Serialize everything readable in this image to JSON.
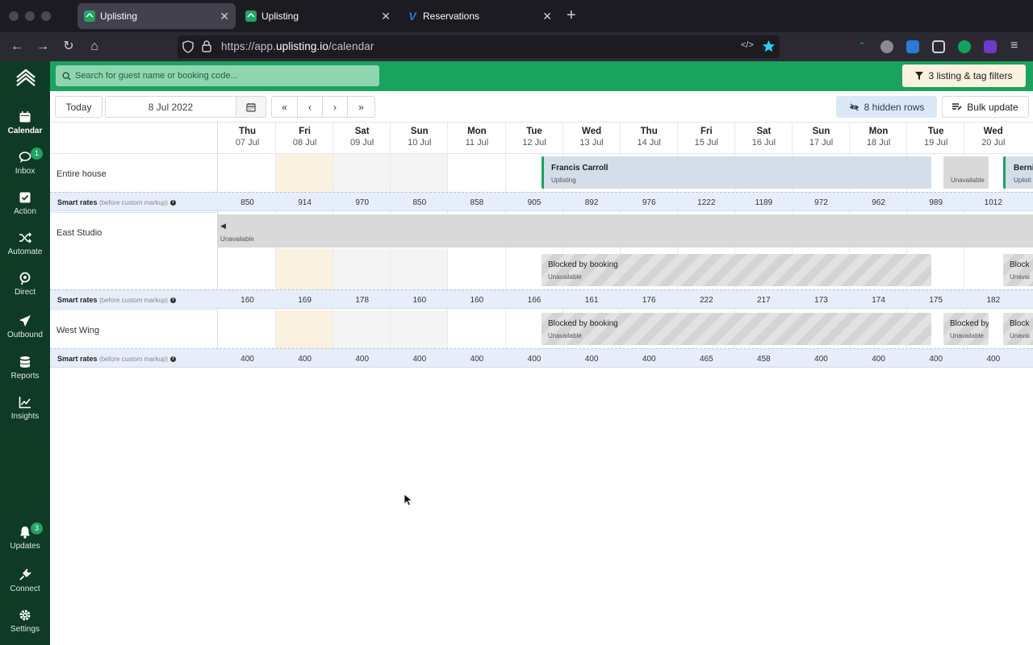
{
  "browser": {
    "tabs": [
      {
        "title": "Uplisting",
        "active": true
      },
      {
        "title": "Uplisting",
        "active": false
      },
      {
        "title": "Reservations",
        "active": false
      }
    ],
    "url_prefix": "https://app.",
    "url_domain": "uplisting.io",
    "url_path": "/calendar"
  },
  "sidebar": {
    "items": [
      {
        "label": "Calendar",
        "icon": "calendar-icon"
      },
      {
        "label": "Inbox",
        "icon": "chat-icon",
        "badge": "1"
      },
      {
        "label": "Action",
        "icon": "check-square-icon"
      },
      {
        "label": "Automate",
        "icon": "shuffle-icon"
      },
      {
        "label": "Direct",
        "icon": "direct-icon"
      },
      {
        "label": "Outbound",
        "icon": "paper-plane-icon"
      },
      {
        "label": "Reports",
        "icon": "database-icon"
      },
      {
        "label": "Insights",
        "icon": "chart-line-icon"
      },
      {
        "label": "Updates",
        "icon": "bell-icon",
        "badge": "3"
      },
      {
        "label": "Connect",
        "icon": "plug-icon"
      },
      {
        "label": "Settings",
        "icon": "gear-icon"
      }
    ]
  },
  "header": {
    "search_placeholder": "Search for guest name or booking code...",
    "filters_label": "3 listing & tag filters"
  },
  "toolbar": {
    "today_label": "Today",
    "date_value": "8 Jul 2022",
    "first_label": "«",
    "prev_label": "‹",
    "next_label": "›",
    "last_label": "»",
    "hidden_rows_label": "8 hidden rows",
    "bulk_update_label": "Bulk update"
  },
  "days": [
    {
      "name": "Thu",
      "date": "07 Jul"
    },
    {
      "name": "Fri",
      "date": "08 Jul"
    },
    {
      "name": "Sat",
      "date": "09 Jul"
    },
    {
      "name": "Sun",
      "date": "10 Jul"
    },
    {
      "name": "Mon",
      "date": "11 Jul"
    },
    {
      "name": "Tue",
      "date": "12 Jul"
    },
    {
      "name": "Wed",
      "date": "13 Jul"
    },
    {
      "name": "Thu",
      "date": "14 Jul"
    },
    {
      "name": "Fri",
      "date": "15 Jul"
    },
    {
      "name": "Sat",
      "date": "16 Jul"
    },
    {
      "name": "Sun",
      "date": "17 Jul"
    },
    {
      "name": "Mon",
      "date": "18 Jul"
    },
    {
      "name": "Tue",
      "date": "19 Jul"
    },
    {
      "name": "Wed",
      "date": "20 Jul"
    }
  ],
  "rates_label": "Smart rates",
  "rates_note": "(before custom markup)",
  "rates_info": "i",
  "listings": [
    {
      "name": "Entire house",
      "rates": [
        "850",
        "914",
        "970",
        "850",
        "858",
        "905",
        "892",
        "976",
        "1222",
        "1189",
        "972",
        "962",
        "989",
        "1012"
      ],
      "booking_name": "Francis Carroll",
      "booking_source": "Uplisting",
      "unavailable_label": "Unavailable",
      "next_booking_name": "Berni",
      "next_booking_source": "Uplisti"
    },
    {
      "name": "East Studio",
      "rates": [
        "160",
        "169",
        "178",
        "160",
        "160",
        "166",
        "161",
        "176",
        "222",
        "217",
        "173",
        "174",
        "175",
        "182"
      ],
      "unavailable_label": "Unavailable",
      "blocked_label": "Blocked by booking",
      "blocked_sub": "Unavailable",
      "next_blocked_label": "Block",
      "next_blocked_sub": "Unavai"
    },
    {
      "name": "West Wing",
      "rates": [
        "400",
        "400",
        "400",
        "400",
        "400",
        "400",
        "400",
        "400",
        "465",
        "458",
        "400",
        "400",
        "400",
        "400"
      ],
      "blocked_label": "Blocked by booking",
      "blocked_sub": "Unavailable",
      "blocked2_label": "Blocked by",
      "blocked2_sub": "Unavailable",
      "next_blocked_label": "Block",
      "next_blocked_sub": "Unavai"
    }
  ],
  "colors": {
    "brand_green": "#1aa35e",
    "sidebar_dark": "#0f3a26",
    "today_highlight": "#fbf1e0",
    "weekend": "#f4f4f4",
    "rates_bg": "#e7eefb"
  }
}
